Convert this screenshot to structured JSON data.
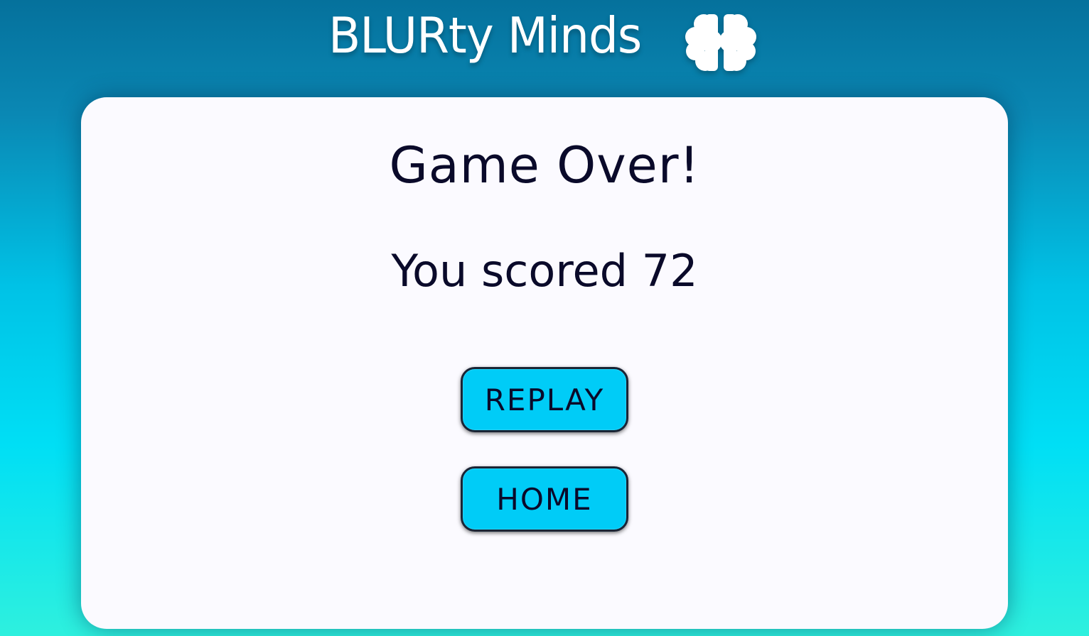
{
  "header": {
    "title": "BLURty Minds",
    "logo_icon": "brain-icon"
  },
  "game_over": {
    "heading": "Game Over!",
    "score_prefix": "You scored",
    "score": 72
  },
  "buttons": {
    "replay_label": "REPLAY",
    "home_label": "HOME"
  },
  "colors": {
    "background_top": "#05719c",
    "background_bottom": "#2ef0de",
    "card": "#fbfaff",
    "button": "#00ccf7",
    "text": "#0a0a2a"
  }
}
